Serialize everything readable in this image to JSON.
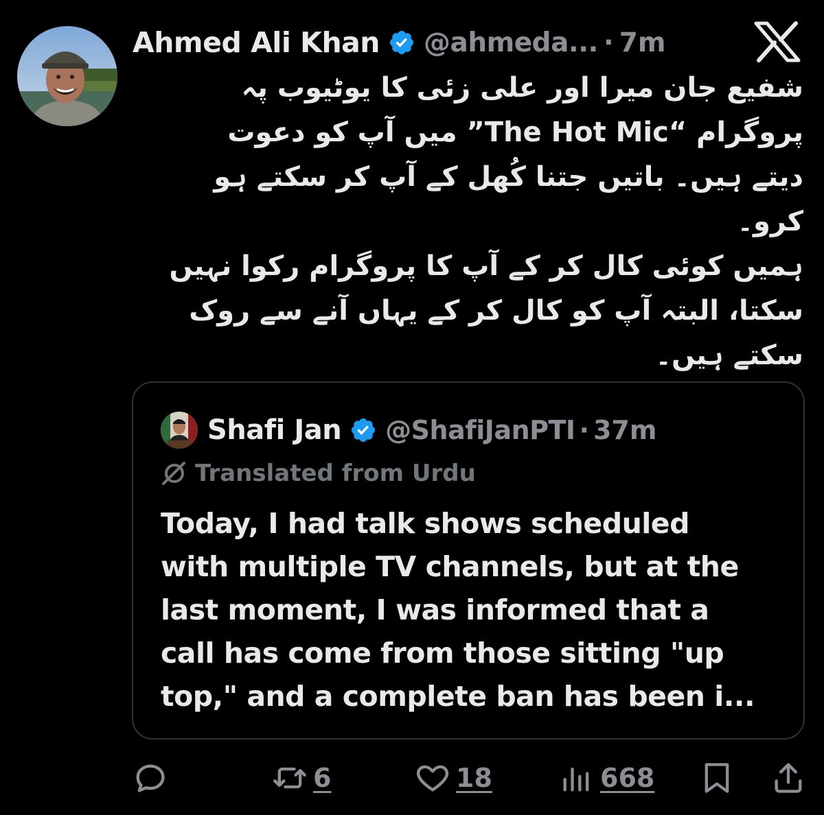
{
  "author": {
    "display_name": "Ahmed Ali Khan",
    "handle": "@ahmeda...",
    "separator": "·",
    "time": "7m"
  },
  "body_urdu_lines": [
    "شفیع جان میرا اور علی زئی کا یوٹیوب پہ",
    "پروگرام “The Hot Mic” میں آپ کو دعوت",
    "دیتے ہیں۔ باتیں جتنا کُھل کے آپ کر سکتے ہو",
    "کرو۔",
    "ہمیں کوئی کال کر کے آپ کا پروگرام رکوا نہیں",
    "سکتا، البتہ آپ کو کال کر کے یہاں آنے سے روک",
    "سکتے ہیں۔"
  ],
  "quoted_tweet": {
    "display_name": "Shafi Jan",
    "handle": "@ShafiJanPTI",
    "separator": "·",
    "time": "37m",
    "translated_label": "Translated from Urdu",
    "body_lines": [
      "Today, I had talk shows scheduled",
      "with multiple TV channels, but at the",
      "last moment, I was informed that a",
      "call has come from those sitting \"up",
      "top,\" and a complete ban has been i..."
    ]
  },
  "actions": {
    "reply": {
      "icon": "reply-icon"
    },
    "retweet": {
      "icon": "retweet-icon",
      "count": "6"
    },
    "like": {
      "icon": "heart-icon",
      "count": "18"
    },
    "views": {
      "icon": "views-icon",
      "count": "668"
    },
    "bookmark": {
      "icon": "bookmark-icon"
    },
    "share": {
      "icon": "share-icon"
    }
  },
  "colors": {
    "background": "#000000",
    "text": "#e7e9ea",
    "muted": "#8b8f94",
    "verified": "#1d9bf0",
    "border": "#2f3336"
  }
}
